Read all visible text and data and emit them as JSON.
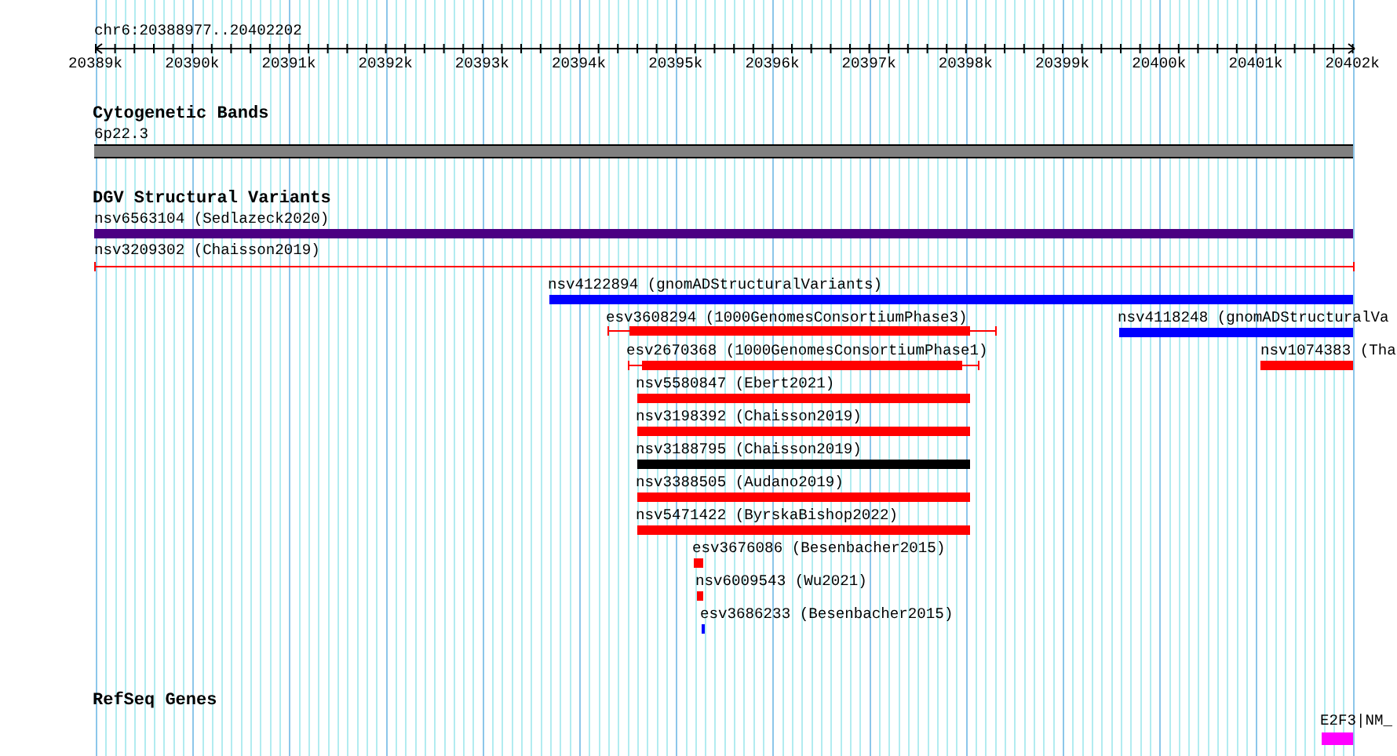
{
  "location": "chr6:20388977..20402202",
  "ruler": {
    "ticks": [
      "20389k",
      "20390k",
      "20391k",
      "20392k",
      "20393k",
      "20394k",
      "20395k",
      "20396k",
      "20397k",
      "20398k",
      "20399k",
      "20400k",
      "20401k",
      "20402k"
    ]
  },
  "tracks": [
    {
      "title": "Cytogenetic Bands",
      "features": [
        {
          "label": "6p22.3",
          "kind": "band",
          "color": "#808080"
        }
      ]
    },
    {
      "title": "DGV Structural Variants",
      "features": [
        {
          "label": "nsv6563104 (Sedlazeck2020)",
          "kind": "bar",
          "color": "#4b0082"
        },
        {
          "label": "nsv3209302 (Chaisson2019)",
          "kind": "line",
          "color": "#ff0000"
        },
        {
          "label": "nsv4122894 (gnomADStructuralVariants)",
          "kind": "bar",
          "color": "#0000ff"
        },
        {
          "label": "esv3608294 (1000GenomesConsortiumPhase3)",
          "kind": "span",
          "color": "#ff0000"
        },
        {
          "label": "nsv4118248 (gnomADStructuralVa",
          "kind": "bar",
          "color": "#0000ff"
        },
        {
          "label": "esv2670368 (1000GenomesConsortiumPhase1)",
          "kind": "span",
          "color": "#ff0000"
        },
        {
          "label": "nsv1074383 (Tha",
          "kind": "bar",
          "color": "#ff0000"
        },
        {
          "label": "nsv5580847 (Ebert2021)",
          "kind": "bar",
          "color": "#ff0000"
        },
        {
          "label": "nsv3198392 (Chaisson2019)",
          "kind": "bar",
          "color": "#ff0000"
        },
        {
          "label": "nsv3188795 (Chaisson2019)",
          "kind": "bar",
          "color": "#000000"
        },
        {
          "label": "nsv3388505 (Audano2019)",
          "kind": "bar",
          "color": "#ff0000"
        },
        {
          "label": "nsv5471422 (ByrskaBishop2022)",
          "kind": "bar",
          "color": "#ff0000"
        },
        {
          "label": "esv3676086 (Besenbacher2015)",
          "kind": "bar",
          "color": "#ff0000"
        },
        {
          "label": "nsv6009543 (Wu2021)",
          "kind": "bar",
          "color": "#ff0000"
        },
        {
          "label": "esv3686233 (Besenbacher2015)",
          "kind": "bar",
          "color": "#0000ff"
        }
      ]
    },
    {
      "title": "RefSeq Genes",
      "features": [
        {
          "label": "E2F3|NM_",
          "kind": "bar",
          "color": "#ff00ff"
        }
      ]
    }
  ]
}
